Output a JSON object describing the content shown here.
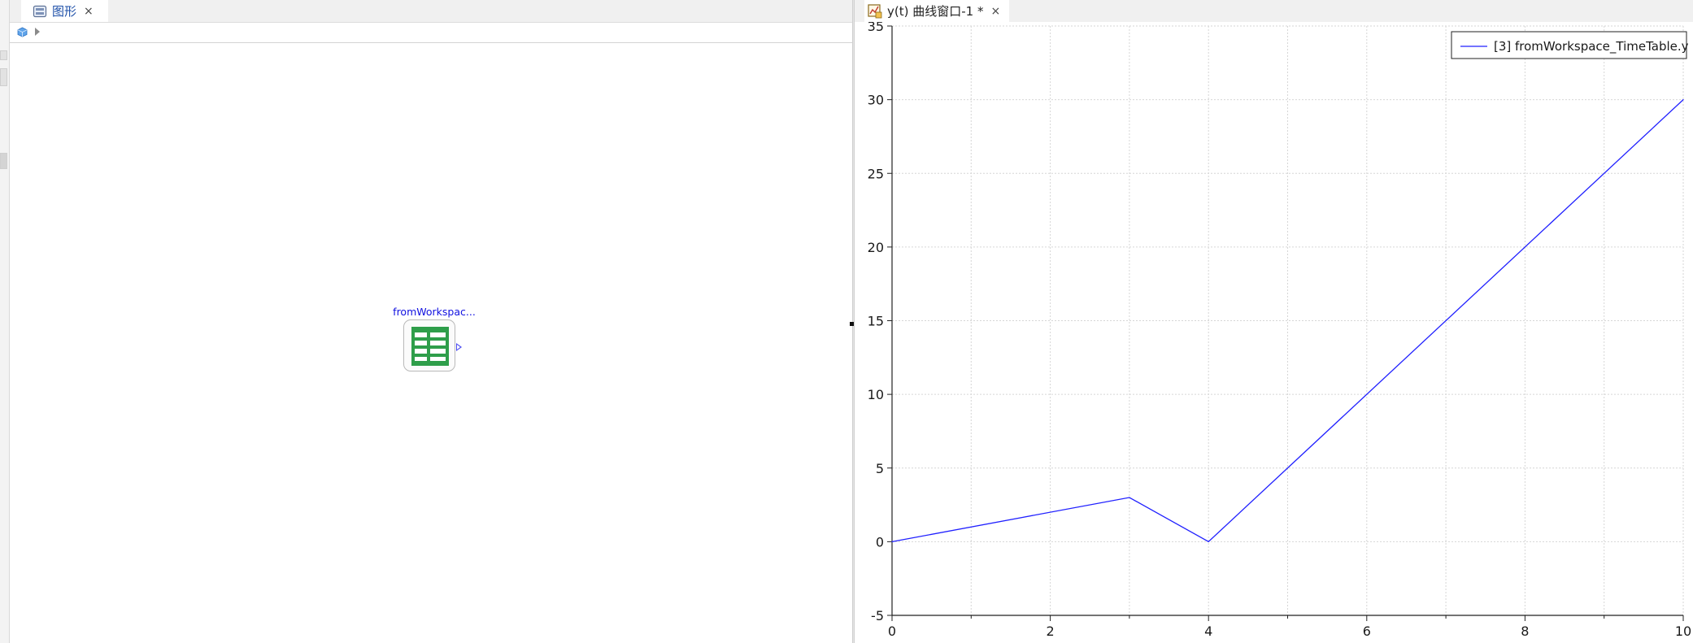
{
  "left_panel": {
    "tab": {
      "label": "图形",
      "close": "×",
      "icon": "diagram-view-icon"
    },
    "toolbar": {
      "icons": [
        "cube-icon",
        "play-icon"
      ]
    },
    "component": {
      "label": "fromWorkspac...",
      "icon": "table-icon",
      "color": "#2e9e4a"
    }
  },
  "right_panel": {
    "tab": {
      "label": "y(t) 曲线窗口-1 *",
      "close": "×",
      "icon": "plot-window-icon"
    },
    "legend": {
      "entries": [
        "[3] fromWorkspace_TimeTable.y"
      ],
      "placement": "top-right"
    }
  },
  "chart_data": {
    "type": "line",
    "title": "",
    "xlabel": "",
    "ylabel": "",
    "xlim": [
      0,
      10
    ],
    "ylim": [
      -5,
      35
    ],
    "xticks": [
      0,
      2,
      4,
      6,
      8,
      10
    ],
    "xticks_minor": [
      1,
      3,
      5,
      7,
      9
    ],
    "yticks": [
      -5,
      0,
      5,
      10,
      15,
      20,
      25,
      30,
      35
    ],
    "grid": true,
    "series": [
      {
        "name": "[3] fromWorkspace_TimeTable.y",
        "color": "#2020ff",
        "x": [
          0,
          3,
          4,
          10
        ],
        "y": [
          0,
          3,
          0,
          30
        ]
      }
    ]
  }
}
